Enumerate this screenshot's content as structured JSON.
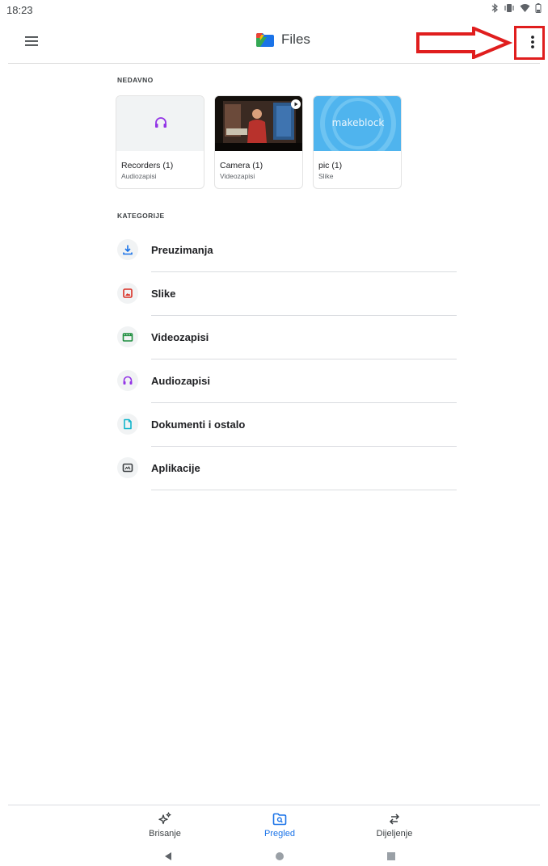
{
  "status": {
    "time": "18:23"
  },
  "appbar": {
    "title": "Files"
  },
  "recent": {
    "label": "NEDAVNO",
    "items": [
      {
        "name": "Recorders (1)",
        "type": "Audiozapisi"
      },
      {
        "name": "Camera (1)",
        "type": "Videozapisi"
      },
      {
        "name": "pic (1)",
        "type": "Slike",
        "thumb_text": "makeblock"
      }
    ]
  },
  "categories": {
    "label": "KATEGORIJE",
    "items": [
      {
        "label": "Preuzimanja",
        "icon": "download-icon",
        "color": "#1a73e8"
      },
      {
        "label": "Slike",
        "icon": "image-icon",
        "color": "#d93025"
      },
      {
        "label": "Videozapisi",
        "icon": "video-icon",
        "color": "#1e8e3e"
      },
      {
        "label": "Audiozapisi",
        "icon": "headphones-icon",
        "color": "#9334e6"
      },
      {
        "label": "Dokumenti i ostalo",
        "icon": "document-icon",
        "color": "#12b5cb"
      },
      {
        "label": "Aplikacije",
        "icon": "apps-icon",
        "color": "#3c4043"
      }
    ]
  },
  "bottom_nav": {
    "items": [
      {
        "label": "Brisanje",
        "icon": "sparkle-icon",
        "active": false
      },
      {
        "label": "Pregled",
        "icon": "browse-folder-icon",
        "active": true
      },
      {
        "label": "Dijeljenje",
        "icon": "swap-arrows-icon",
        "active": false
      }
    ]
  },
  "colors": {
    "accent": "#1a73e8",
    "annotation": "#e01e1e"
  }
}
